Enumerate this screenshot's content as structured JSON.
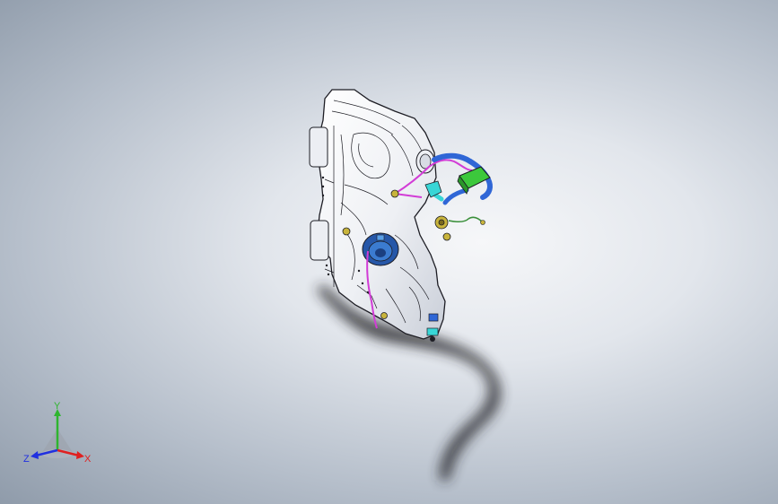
{
  "viewport": {
    "background_center": "#f6f7f9",
    "background_edge": "#8f9baa"
  },
  "model": {
    "icon": "fuel-tank-assembly-model",
    "colors": {
      "body": "#f4f5f8",
      "edge": "#1d1d24",
      "pipe_magenta": "#d23cd6",
      "hose_blue": "#2f66d6",
      "hose_cyan": "#38d6d6",
      "connector_green": "#3cc83c",
      "pump_blue": "#2657a8",
      "fitting_yellow": "#c8b43c",
      "shadow": "#2a2a2e"
    }
  },
  "triad": {
    "x_label": "X",
    "y_label": "Y",
    "z_label": "Z",
    "x_color": "#e02020",
    "y_color": "#2fb52f",
    "z_color": "#2030e0"
  }
}
